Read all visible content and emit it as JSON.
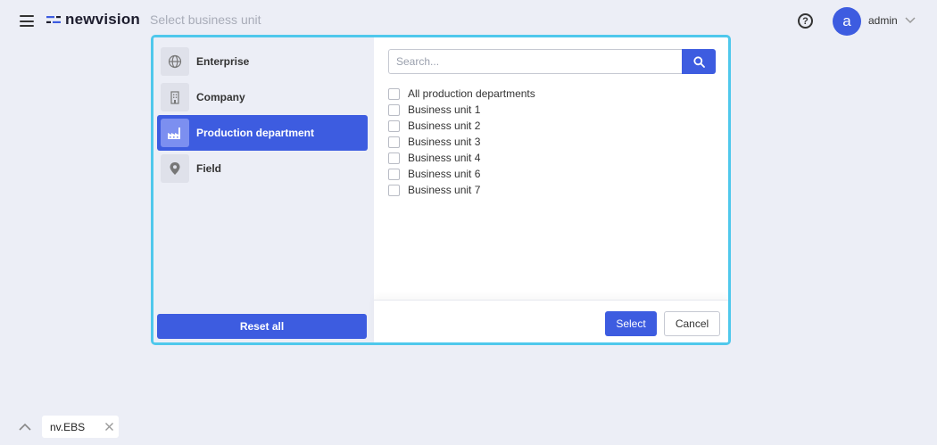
{
  "header": {
    "menu_icon": "hamburger-menu-icon",
    "logo_text": "newvision",
    "page_title": "Select business unit",
    "help_icon": "question-circle-icon",
    "user": {
      "avatar_letter": "a",
      "name": "admin"
    }
  },
  "dialog": {
    "levels": [
      {
        "label": "Enterprise",
        "icon": "globe-icon",
        "active": false
      },
      {
        "label": "Company",
        "icon": "building-icon",
        "active": false
      },
      {
        "label": "Production department",
        "icon": "factory-icon",
        "active": true
      },
      {
        "label": "Field",
        "icon": "map-pin-icon",
        "active": false
      }
    ],
    "reset_label": "Reset all",
    "search": {
      "placeholder": "Search...",
      "value": ""
    },
    "units": [
      {
        "label": "All production departments",
        "checked": false
      },
      {
        "label": "Business unit 1",
        "checked": false
      },
      {
        "label": "Business unit 2",
        "checked": false
      },
      {
        "label": "Business unit 3",
        "checked": false
      },
      {
        "label": "Business unit 4",
        "checked": false
      },
      {
        "label": "Business unit 6",
        "checked": false
      },
      {
        "label": "Business unit 7",
        "checked": false
      }
    ],
    "select_label": "Select",
    "cancel_label": "Cancel"
  },
  "tabs": [
    {
      "label": "nv.EBS"
    }
  ],
  "colors": {
    "accent": "#3d5ce0",
    "dialog_border": "#4fc8ec",
    "background": "#eceef6"
  }
}
